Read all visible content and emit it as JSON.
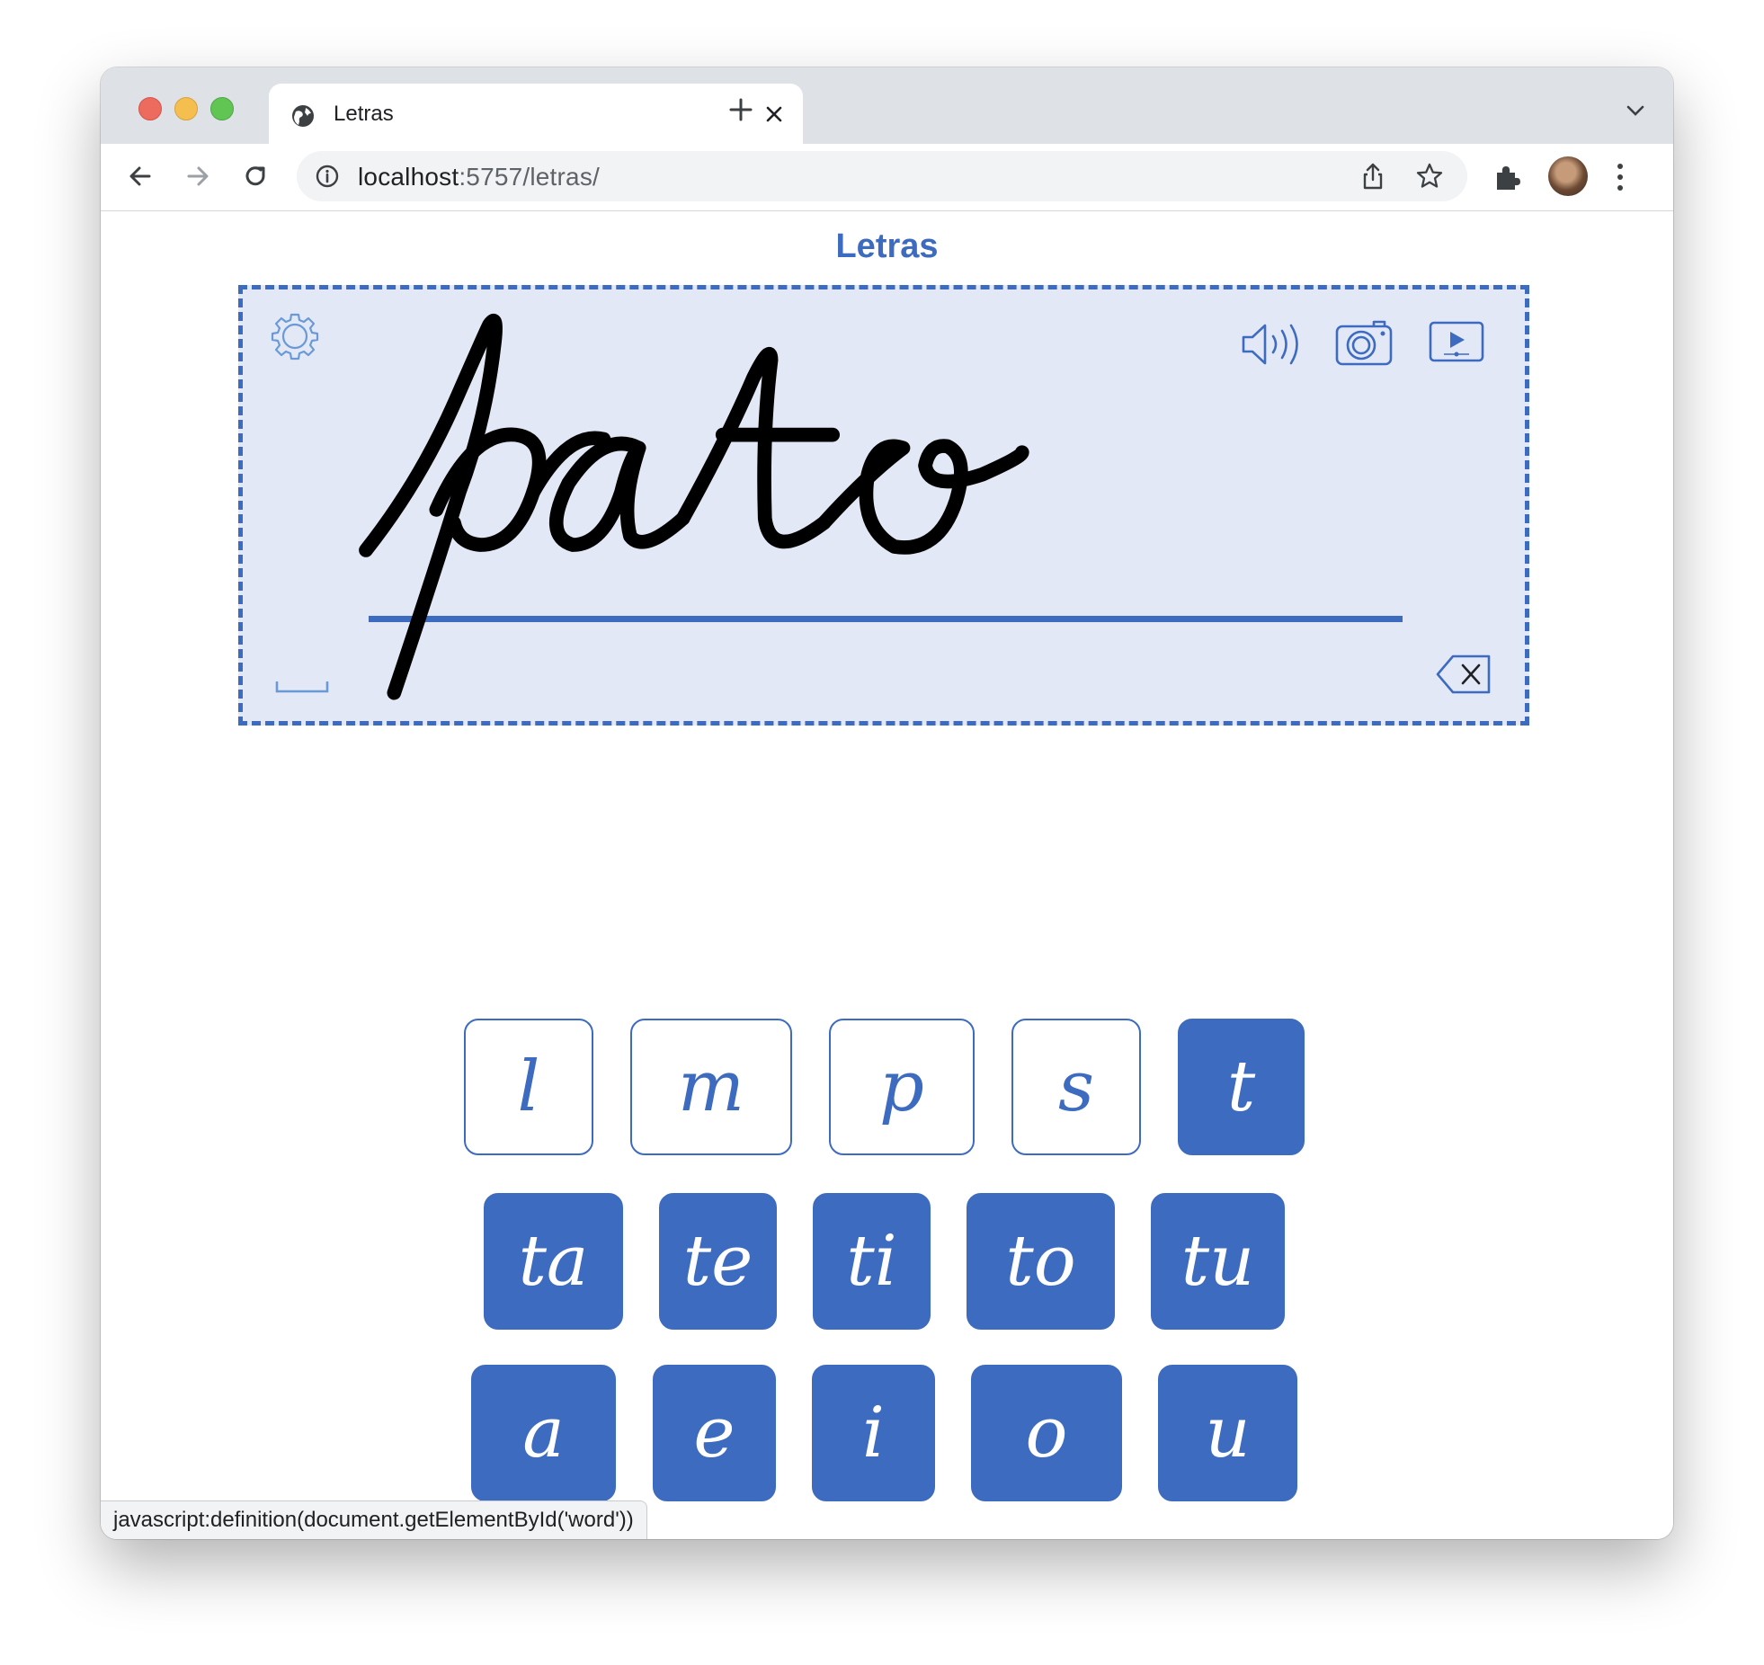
{
  "browser": {
    "tab_title": "Letras",
    "url_host": "localhost",
    "url_rest": ":5757/letras/"
  },
  "app": {
    "title": "Letras",
    "word": "pato",
    "colors": {
      "accent": "#3d6bbf",
      "board_bg": "#e3e8f6"
    }
  },
  "keyboard": {
    "row1": [
      {
        "label": "l",
        "style": "outline"
      },
      {
        "label": "m",
        "style": "outline"
      },
      {
        "label": "p",
        "style": "outline"
      },
      {
        "label": "s",
        "style": "outline"
      },
      {
        "label": "t",
        "style": "filled"
      }
    ],
    "row2": [
      {
        "label": "ta",
        "style": "filled"
      },
      {
        "label": "te",
        "style": "filled"
      },
      {
        "label": "ti",
        "style": "filled"
      },
      {
        "label": "to",
        "style": "filled"
      },
      {
        "label": "tu",
        "style": "filled"
      }
    ],
    "row3": [
      {
        "label": "a",
        "style": "filled"
      },
      {
        "label": "e",
        "style": "filled"
      },
      {
        "label": "i",
        "style": "filled"
      },
      {
        "label": "o",
        "style": "filled"
      },
      {
        "label": "u",
        "style": "filled"
      }
    ]
  },
  "statusbar": {
    "text": "javascript:definition(document.getElementById('word'))"
  }
}
